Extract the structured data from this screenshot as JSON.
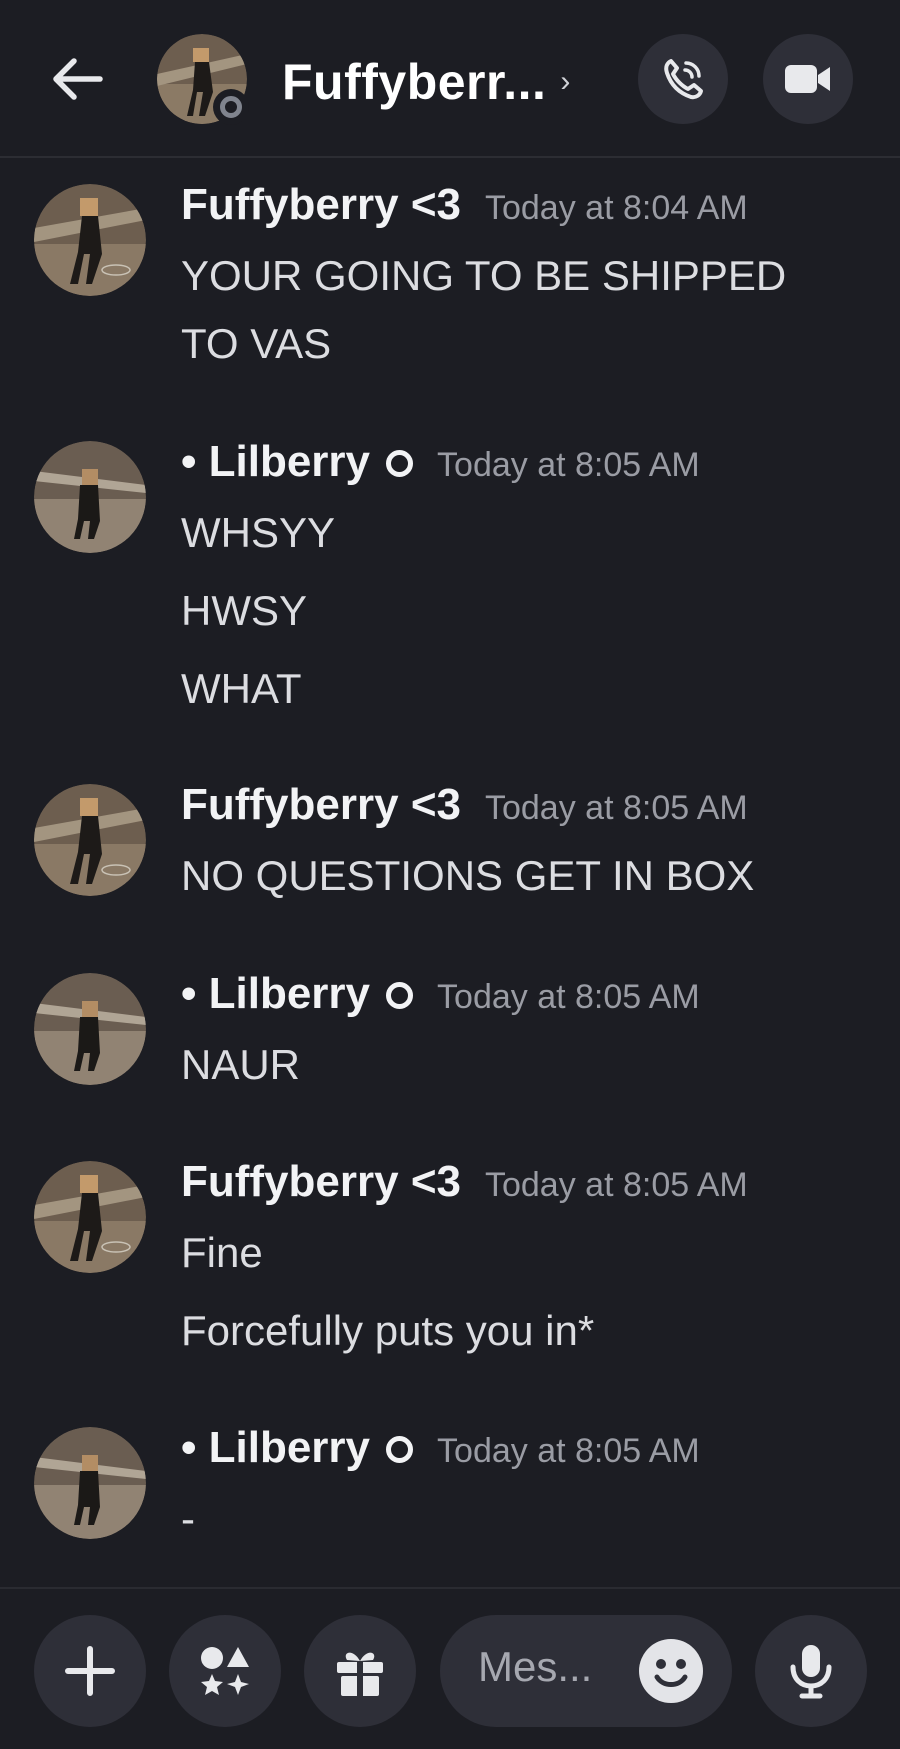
{
  "header": {
    "title": "Fuffyberr...",
    "chevron": "›",
    "status": "offline"
  },
  "messages": [
    {
      "author": "Fuffyberry <3",
      "timestamp": "Today at 8:04 AM",
      "lines": [
        "YOUR GOING TO BE SHIPPED",
        "TO VAS"
      ]
    },
    {
      "author": "• Lilberry",
      "timestamp": "Today at 8:05 AM",
      "lines": [
        "WHSYY",
        "HWSY",
        "WHAT"
      ]
    },
    {
      "author": "Fuffyberry <3",
      "timestamp": "Today at 8:05 AM",
      "lines": [
        "NO QUESTIONS GET IN BOX"
      ]
    },
    {
      "author": "• Lilberry",
      "timestamp": "Today at 8:05 AM",
      "lines": [
        "NAUR"
      ]
    },
    {
      "author": "Fuffyberry <3",
      "timestamp": "Today at 8:05 AM",
      "lines": [
        "Fine",
        "Forcefully puts you in*"
      ]
    },
    {
      "author": "• Lilberry",
      "timestamp": "Today at 8:05 AM",
      "lines": [
        "-"
      ]
    }
  ],
  "composer": {
    "placeholder": "Mes..."
  },
  "icons": {
    "back": "arrow-left-icon",
    "call": "phone-call-icon",
    "video": "video-camera-icon",
    "plus": "plus-icon",
    "apps": "apps-shapes-icon",
    "gift": "gift-icon",
    "emoji": "emoji-smile-icon",
    "mic": "microphone-icon"
  },
  "colors": {
    "background": "#1c1d23",
    "button_bg": "#2e2f38",
    "timestamp": "#9a9ca4"
  }
}
